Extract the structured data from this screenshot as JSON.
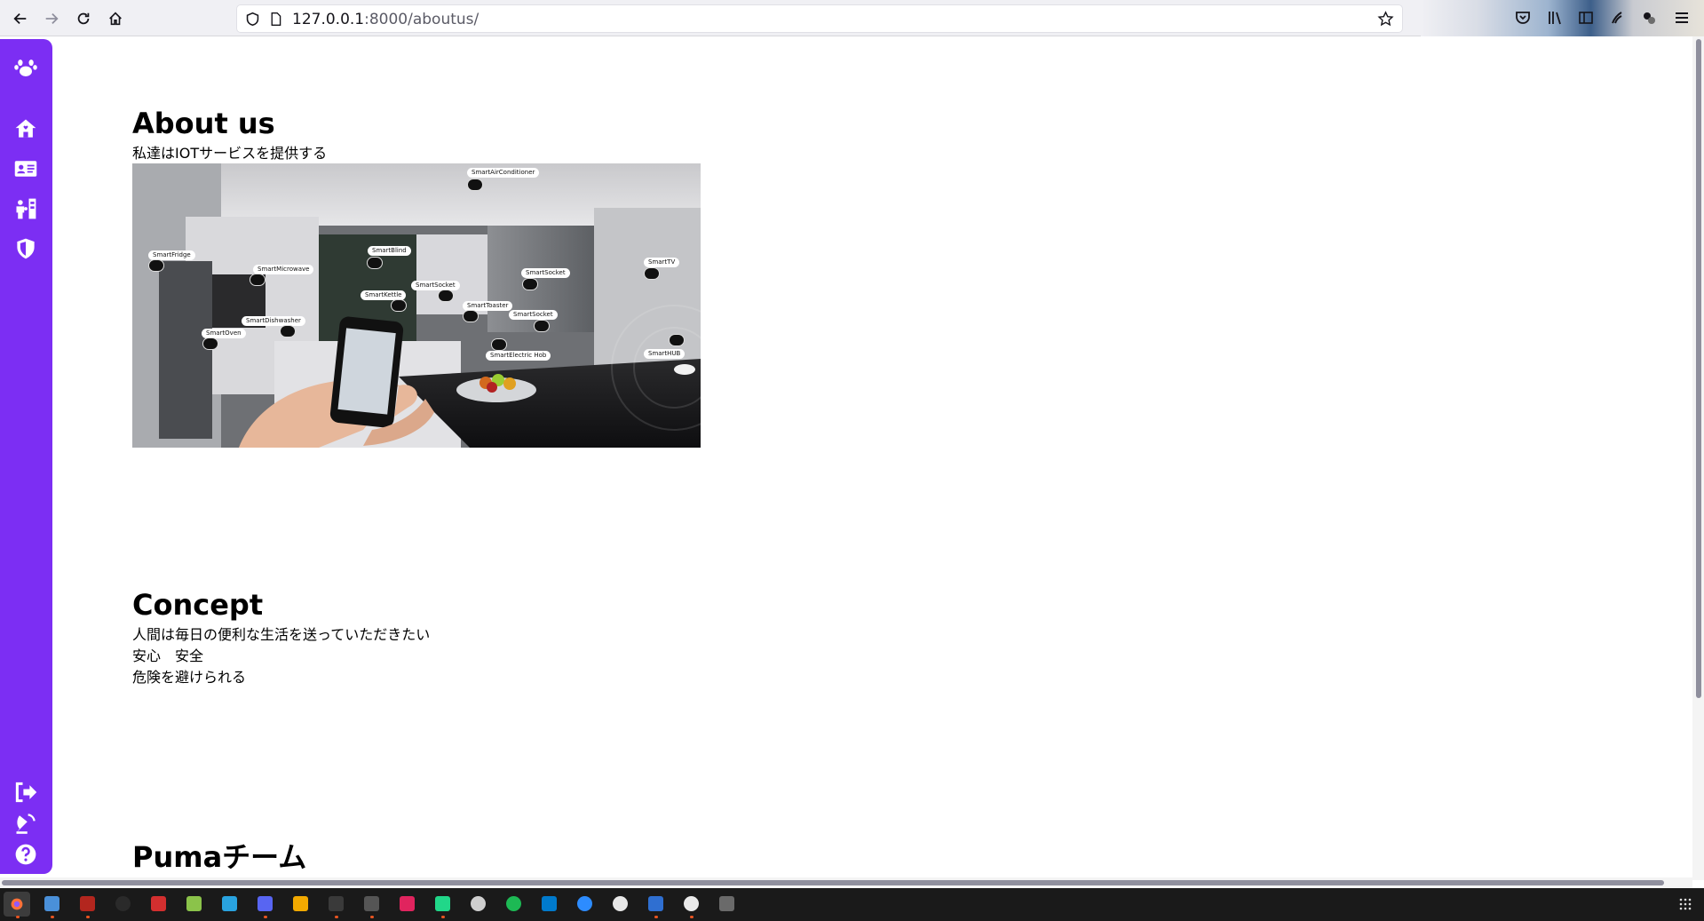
{
  "browser": {
    "url_host": "127.0.0.1",
    "url_rest": ":8000/aboutus/",
    "icons": [
      "back-icon",
      "forward-icon",
      "reload-icon",
      "home-icon",
      "shield-icon",
      "page-icon",
      "bookmark-star-icon",
      "pocket-icon",
      "library-icon",
      "reader-view-icon",
      "extension-icon",
      "account-icon",
      "menu-icon"
    ]
  },
  "sidebar": {
    "accent": "#7c2ef3",
    "items": [
      {
        "icon": "paw-icon"
      },
      {
        "icon": "house-icon"
      },
      {
        "icon": "id-card-icon"
      },
      {
        "icon": "people-roof-icon"
      },
      {
        "icon": "shield-halved-icon"
      },
      {
        "icon": "logout-icon"
      },
      {
        "icon": "satellite-dish-icon"
      },
      {
        "icon": "question-icon"
      }
    ]
  },
  "about": {
    "title": "About us",
    "subtitle": "私達はIOTサービスを提供する",
    "image_tags": [
      "SmartAirConditioner",
      "SmartBlind",
      "SmartFridge",
      "SmartMicrowave",
      "SmartSocket",
      "SmartSocket",
      "SmartTV",
      "SmartKettle",
      "SmartToaster",
      "SmartSocket",
      "SmartDishwasher",
      "SmartOven",
      "SmartElectric Hob",
      "SmartHUB"
    ]
  },
  "concept": {
    "title": "Concept",
    "lines": [
      "人間は毎日の便利な生活を送っていただきたい",
      "安心　安全",
      "危険を避けられる"
    ]
  },
  "team": {
    "title": "Pumaチーム"
  },
  "taskbar": {
    "apps": [
      "firefox-icon",
      "files-icon",
      "app-red-icon",
      "steam-icon",
      "pdf-icon",
      "notes-icon",
      "wps-icon",
      "discord-icon",
      "folder-icon",
      "audio-icon",
      "terminal-icon",
      "jetbrains-icon",
      "pycharm-icon",
      "obs-icon",
      "spotify-icon",
      "vscode-icon",
      "zoom-icon",
      "slack-icon",
      "bible-icon",
      "clock-icon",
      "window-icon"
    ]
  }
}
